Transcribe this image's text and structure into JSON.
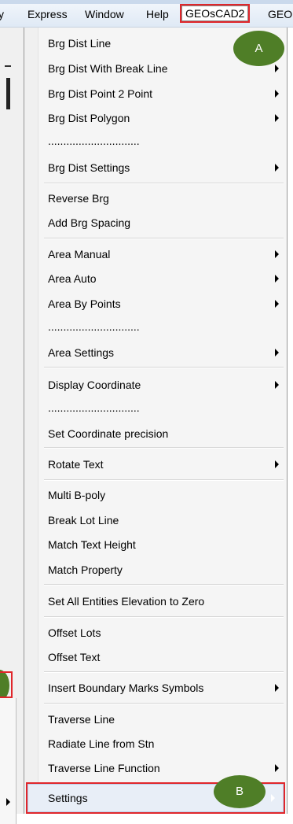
{
  "menubar": {
    "items": [
      "y",
      "Express",
      "Window",
      "Help",
      "GEOsCAD2",
      "GEO"
    ]
  },
  "menu": {
    "items": [
      {
        "label": "Brg Dist Line",
        "submenu": false
      },
      {
        "label": "Brg Dist With Break Line",
        "submenu": true
      },
      {
        "label": "Brg Dist Point 2 Point",
        "submenu": true
      },
      {
        "label": "Brg Dist Polygon",
        "submenu": true
      },
      {
        "label": "..............................",
        "submenu": false
      },
      {
        "label": "Brg Dist Settings",
        "submenu": true
      },
      {
        "label": "Reverse Brg",
        "submenu": false
      },
      {
        "label": "Add Brg Spacing",
        "submenu": false
      },
      {
        "label": "Area Manual",
        "submenu": true
      },
      {
        "label": "Area Auto",
        "submenu": true
      },
      {
        "label": "Area By Points",
        "submenu": true
      },
      {
        "label": "..............................",
        "submenu": false
      },
      {
        "label": "Area Settings",
        "submenu": true
      },
      {
        "label": "Display Coordinate",
        "submenu": true
      },
      {
        "label": "..............................",
        "submenu": false
      },
      {
        "label": "Set Coordinate precision",
        "submenu": false
      },
      {
        "label": "Rotate Text",
        "submenu": true
      },
      {
        "label": "Multi B-poly",
        "submenu": false
      },
      {
        "label": "Break Lot Line",
        "submenu": false
      },
      {
        "label": "Match Text Height",
        "submenu": false
      },
      {
        "label": "Match Property",
        "submenu": false
      },
      {
        "label": "Set All Entities Elevation to Zero",
        "submenu": false
      },
      {
        "label": "Offset Lots",
        "submenu": false
      },
      {
        "label": "Offset Text",
        "submenu": false
      },
      {
        "label": "Insert Boundary Marks Symbols",
        "submenu": true
      },
      {
        "label": "Traverse Line",
        "submenu": false
      },
      {
        "label": "Radiate Line from Stn",
        "submenu": false
      },
      {
        "label": "Traverse Line Function",
        "submenu": true
      },
      {
        "label": "Settings",
        "submenu": true,
        "selected": true
      }
    ]
  },
  "callouts": {
    "a": "A",
    "b": "B"
  },
  "colors": {
    "highlight": "#e0262b",
    "callout": "#4f7e27"
  }
}
